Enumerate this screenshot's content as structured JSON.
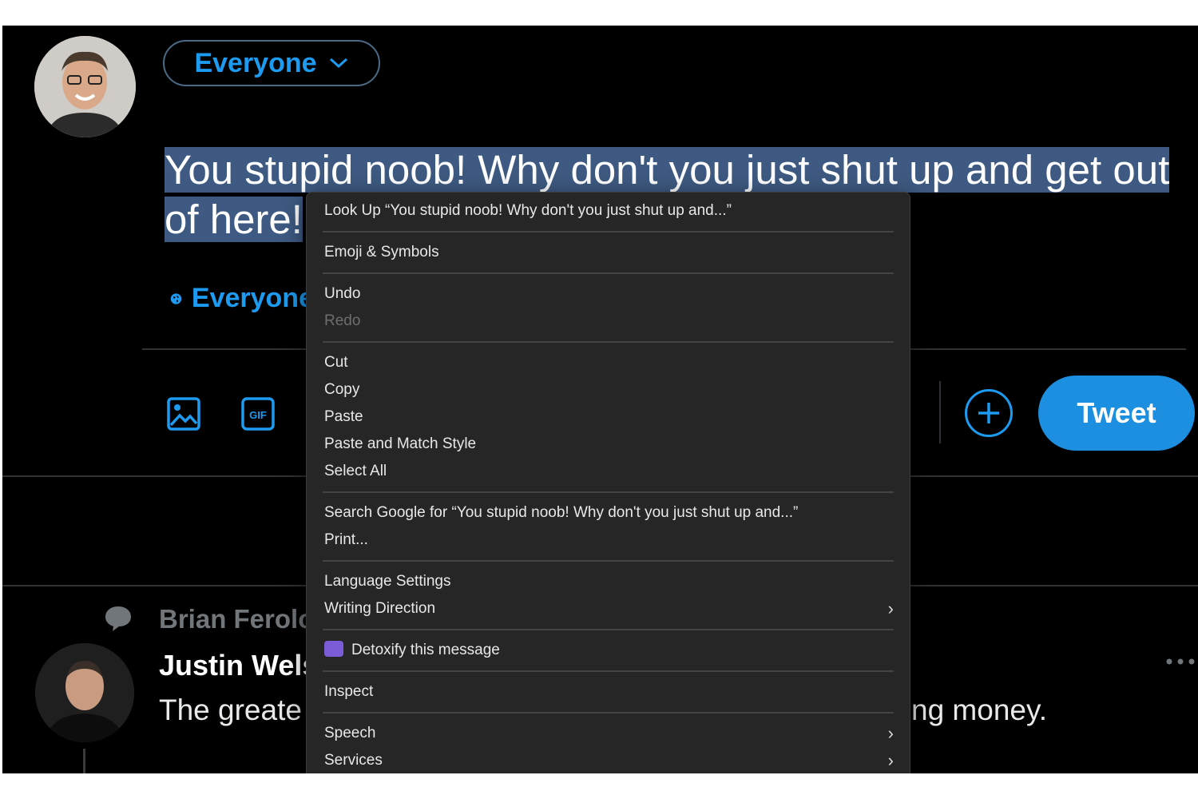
{
  "compose": {
    "audience_label": "Everyone",
    "text_line1": "You stupid noob! Why don't you just shut up and get out",
    "text_line2": "of here!",
    "reply_setting_label": "Everyone",
    "tweet_button_label": "Tweet"
  },
  "feed": {
    "retweeted_by": "Brian Ferolo",
    "author": "Justin Welsh",
    "text_left": "The greate",
    "text_right": "ng money."
  },
  "context_menu": {
    "look_up": "Look Up “You stupid noob! Why don't you just shut up and...”",
    "emoji_symbols": "Emoji & Symbols",
    "undo": "Undo",
    "redo": "Redo",
    "cut": "Cut",
    "copy": "Copy",
    "paste": "Paste",
    "paste_match_style": "Paste and Match Style",
    "select_all": "Select All",
    "search_google": "Search Google for “You stupid noob! Why don't you just shut up and...”",
    "print": "Print...",
    "language_settings": "Language Settings",
    "writing_direction": "Writing Direction",
    "detoxify": "Detoxify this message",
    "inspect": "Inspect",
    "speech": "Speech",
    "services": "Services"
  },
  "colors": {
    "accent": "#1d9bf0",
    "selection": "#3e5a82",
    "menu_bg": "#262626"
  }
}
